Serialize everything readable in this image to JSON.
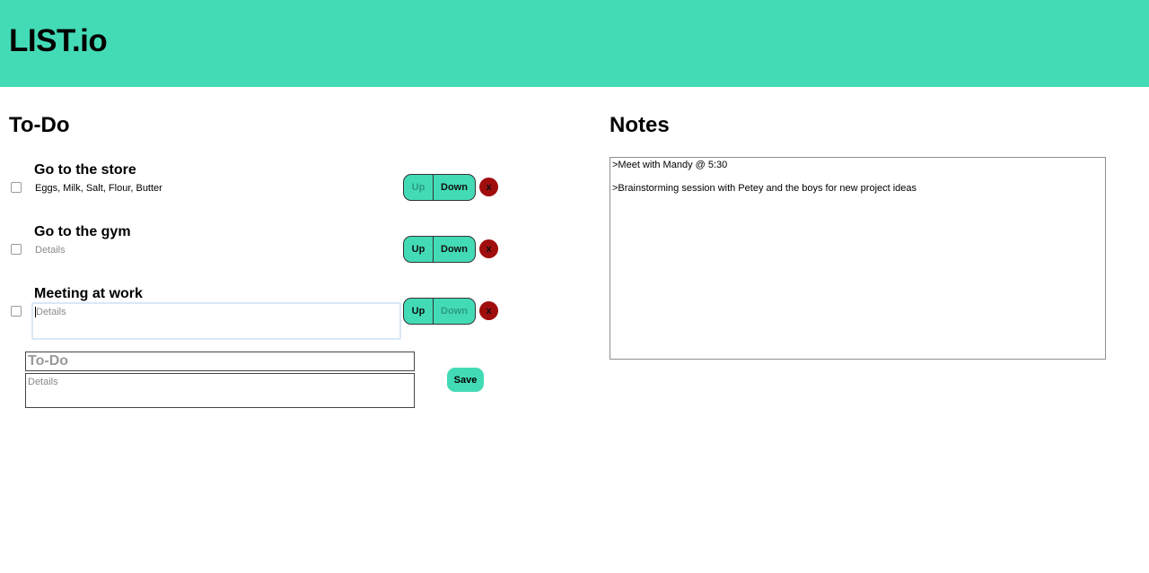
{
  "header": {
    "brand": "LIST.io"
  },
  "todo": {
    "title": "To-Do",
    "tasks": [
      {
        "name": "Go to the store",
        "details": "Eggs, Milk, Salt, Flour, Butter",
        "up_label": "Up",
        "down_label": "Down",
        "delete_label": "x"
      },
      {
        "name": "Go to the gym",
        "details_placeholder": "Details",
        "up_label": "Up",
        "down_label": "Down",
        "delete_label": "x"
      },
      {
        "name": "Meeting at work",
        "details_placeholder": "Details",
        "up_label": "Up",
        "down_label": "Down",
        "delete_label": "x"
      }
    ],
    "new_task": {
      "title_placeholder": "To-Do",
      "details_placeholder": "Details",
      "save_label": "Save"
    }
  },
  "notes": {
    "title": "Notes",
    "lines": [
      ">Meet with Mandy @ 5:30",
      ">Brainstorming session with Petey and the boys for new project ideas"
    ]
  },
  "colors": {
    "accent": "#43dbb6",
    "delete": "#a00d0d"
  }
}
